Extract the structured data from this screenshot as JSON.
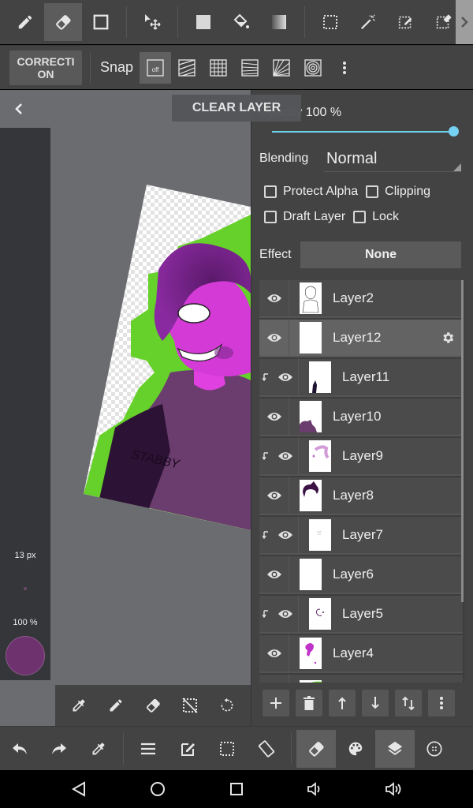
{
  "top_toolbar": {
    "tools": [
      {
        "id": "pen",
        "icon": "pen-icon",
        "active": false
      },
      {
        "id": "eraser",
        "icon": "eraser-icon",
        "active": true
      },
      {
        "id": "shape",
        "icon": "rectangle-shape-icon",
        "active": false
      },
      {
        "id": "move",
        "icon": "move-icon",
        "active": false
      },
      {
        "id": "fill-rect",
        "icon": "fill-square-icon",
        "active": false
      },
      {
        "id": "bucket",
        "icon": "paint-bucket-icon",
        "active": false
      },
      {
        "id": "gradient",
        "icon": "gradient-icon",
        "active": false
      },
      {
        "id": "select-rect",
        "icon": "rect-select-icon",
        "active": false
      },
      {
        "id": "magic-wand",
        "icon": "magic-wand-icon",
        "active": false
      },
      {
        "id": "select-pen",
        "icon": "select-pen-icon",
        "active": false
      },
      {
        "id": "select-eraser",
        "icon": "select-eraser-icon",
        "active": false
      }
    ],
    "more_icon": "chevron-right-icon"
  },
  "snap_bar": {
    "correction_label": "CORRECTION",
    "snap_label": "Snap",
    "snap_off_label": "off",
    "modes": [
      "off",
      "parallel",
      "grid",
      "perspective-lines",
      "radial",
      "concentric"
    ]
  },
  "canvas": {
    "clear_layer_label": "CLEAR LAYER",
    "brush_size": "13 px",
    "brush_opacity": "100 %",
    "current_color": "#6e336e",
    "artwork_text": "STABBY"
  },
  "layer_panel": {
    "opacity_label": "Opacity 100 %",
    "opacity_value": 100,
    "blending_label": "Blending",
    "blending_value": "Normal",
    "checkboxes": [
      {
        "label": "Protect Alpha",
        "checked": false
      },
      {
        "label": "Clipping",
        "checked": false
      },
      {
        "label": "Draft Layer",
        "checked": false
      },
      {
        "label": "Lock",
        "checked": false
      }
    ],
    "effect_label": "Effect",
    "effect_value": "None",
    "layers": [
      {
        "name": "Layer2",
        "clipped": false,
        "visible": true,
        "selected": false
      },
      {
        "name": "Layer12",
        "clipped": false,
        "visible": true,
        "selected": true
      },
      {
        "name": "Layer11",
        "clipped": true,
        "visible": true,
        "selected": false
      },
      {
        "name": "Layer10",
        "clipped": false,
        "visible": true,
        "selected": false
      },
      {
        "name": "Layer9",
        "clipped": true,
        "visible": true,
        "selected": false
      },
      {
        "name": "Layer8",
        "clipped": false,
        "visible": true,
        "selected": false
      },
      {
        "name": "Layer7",
        "clipped": true,
        "visible": true,
        "selected": false
      },
      {
        "name": "Layer6",
        "clipped": false,
        "visible": true,
        "selected": false
      },
      {
        "name": "Layer5",
        "clipped": true,
        "visible": true,
        "selected": false
      },
      {
        "name": "Layer4",
        "clipped": false,
        "visible": true,
        "selected": false
      }
    ],
    "actions": [
      "add-layer",
      "delete-layer",
      "move-up",
      "move-down",
      "swap",
      "more"
    ]
  },
  "sub_toolbar": [
    "eyedropper",
    "pen",
    "eraser",
    "deselect",
    "rotate-reset"
  ],
  "bottom_toolbar": {
    "items": [
      "undo",
      "redo",
      "eyedropper",
      "menu",
      "edit",
      "selection",
      "rotate-canvas",
      "eraser",
      "palette",
      "layers",
      "more"
    ],
    "active": [
      "eraser",
      "layers"
    ]
  },
  "nav_bar": [
    "back",
    "home",
    "recents",
    "volume-down",
    "volume-up"
  ],
  "colors": {
    "toolbar_bg": "#434343",
    "canvas_bg": "#6b6c70",
    "accent_slider": "#74d1f2",
    "selected_layer": "#636363"
  }
}
